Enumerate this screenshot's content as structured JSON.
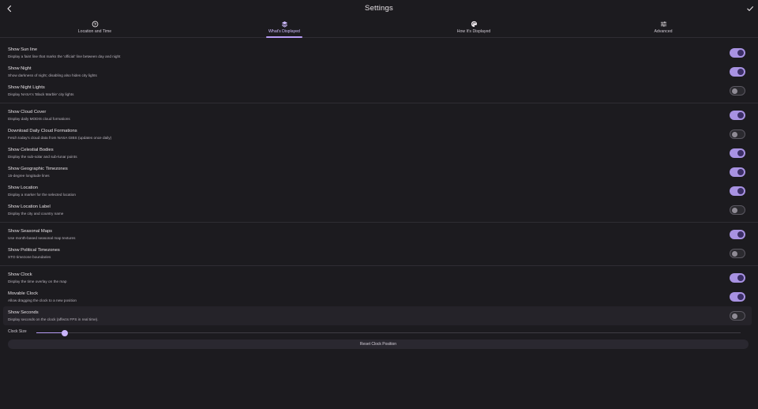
{
  "header": {
    "title": "Settings",
    "back_icon": "chevron-left-icon",
    "done_icon": "check-icon"
  },
  "tabs": [
    {
      "label": "Location and Time",
      "icon": "globe-icon",
      "active": false
    },
    {
      "label": "What's Displayed",
      "icon": "layers-icon",
      "active": true
    },
    {
      "label": "How It's Displayed",
      "icon": "palette-icon",
      "active": false
    },
    {
      "label": "Advanced",
      "icon": "sliders-icon",
      "active": false
    }
  ],
  "sections": [
    [
      {
        "title": "Show Sun line",
        "desc": "Display a faint line that marks the 'official' line between day and night",
        "on": true
      },
      {
        "title": "Show Night",
        "desc": "Show darkness of night; disabling also hides city lights",
        "on": true
      },
      {
        "title": "Show Night Lights",
        "desc": "Display NASA's 'Black Marble' city lights",
        "on": false
      }
    ],
    [
      {
        "title": "Show Cloud Cover",
        "desc": "Display daily MODIS cloud formations",
        "on": true
      },
      {
        "title": "Download Daily Cloud Formations",
        "desc": "Fetch today's cloud data from NASA GIBS (updates once daily)",
        "on": false
      },
      {
        "title": "Show Celestial Bodies",
        "desc": "Display the sub-solar and sub-lunar points",
        "on": true
      },
      {
        "title": "Show Geographic Timezones",
        "desc": "15-degree longitude lines",
        "on": true
      },
      {
        "title": "Show Location",
        "desc": "Display a marker for the selected location",
        "on": true
      },
      {
        "title": "Show Location Label",
        "desc": "Display the city and country name",
        "on": false
      }
    ],
    [
      {
        "title": "Show Seasonal Maps",
        "desc": "Use month-based seasonal map textures",
        "on": true
      },
      {
        "title": "Show Political Timezones",
        "desc": "STO timezone boundaries",
        "on": false
      }
    ],
    [
      {
        "title": "Show Clock",
        "desc": "Display the time overlay on the map",
        "on": true
      },
      {
        "title": "Movable Clock",
        "desc": "Allow dragging the clock to a new position",
        "on": true
      },
      {
        "title": "Show Seconds",
        "desc": "Display seconds on the clock (affects FPS in real time).",
        "on": false,
        "highlight": true
      }
    ]
  ],
  "clock_size": {
    "label": "Clock Size",
    "value": 0.04
  },
  "reset_button": {
    "label": "Reset Clock Position"
  },
  "colors": {
    "accent": "#b79cf5",
    "toggle_on": "#a892e2",
    "background": "#1c1b1f"
  }
}
